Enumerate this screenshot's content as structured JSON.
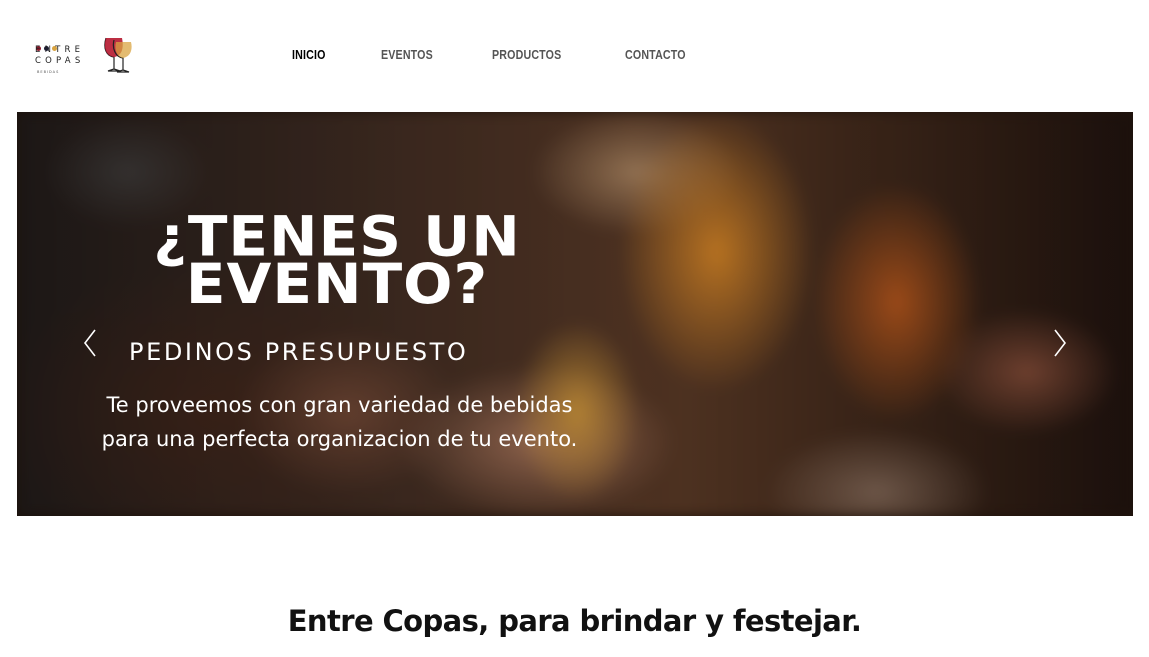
{
  "brand": {
    "line1": "ENTRE",
    "line2": "COPAS",
    "line3": "BEBIDAS",
    "dot_colors": [
      "#8b1a2b",
      "#1c1c3a",
      "#d9a441"
    ],
    "glass_color": "#b5172f"
  },
  "nav": {
    "items": [
      {
        "label": "INICIO",
        "active": true
      },
      {
        "label": "EVENTOS",
        "active": false
      },
      {
        "label": "PRODUCTOS",
        "active": false
      },
      {
        "label": "CONTACTO",
        "active": false
      }
    ]
  },
  "hero": {
    "title_line1": "¿TENES UN",
    "title_line2": "EVENTO?",
    "subtitle": "PEDINOS PRESUPUESTO",
    "desc_line1": "Te proveemos con gran variedad de bebidas",
    "desc_line2": "para una perfecta organizacion de tu evento.",
    "prev_icon": "chevron-left-icon",
    "next_icon": "chevron-right-icon"
  },
  "tagline": "Entre Copas, para brindar y festejar."
}
